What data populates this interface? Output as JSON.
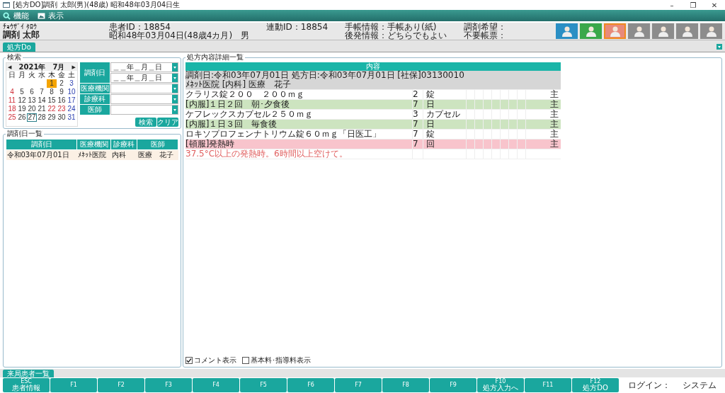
{
  "window": {
    "title": "[処方DO]調剤 太郎(男)(48歳) 昭和48年03月04日生"
  },
  "window_controls": [
    "–",
    "❐",
    "✕"
  ],
  "menu": [
    {
      "label": "機能"
    },
    {
      "label": "表示"
    }
  ],
  "patient": {
    "kana": "ﾁｮｳｻﾞｲ ﾀﾛｳ",
    "name": "調剤 太郎",
    "fields": [
      [
        "患者ID：18854",
        "昭和48年03月04日(48歳4カ月)　男"
      ],
      [
        "連動ID：18854"
      ],
      [
        "手帳情報：手帳あり(紙)",
        "後発情報：どちらでもよい"
      ],
      [
        "調剤希望：",
        "不要帳票："
      ]
    ]
  },
  "toolbar": [
    {
      "color": "#2a8fc4",
      "selected": false
    },
    {
      "color": "#3aa84a",
      "selected": false
    },
    {
      "color": "#e88a7a",
      "selected": true
    },
    {
      "color": "#8c8c8c",
      "selected": false
    },
    {
      "color": "#8c8c8c",
      "selected": false
    },
    {
      "color": "#8c8c8c",
      "selected": false
    },
    {
      "color": "#8c8c8c",
      "selected": false
    }
  ],
  "tabs": [
    {
      "label": "処方Do",
      "selected": true
    }
  ],
  "search": {
    "title": "検索",
    "calendar": {
      "month": "2021年　7月",
      "prev": "◀",
      "next": "▶",
      "weekdays": [
        "日",
        "月",
        "火",
        "水",
        "木",
        "金",
        "土"
      ],
      "weeks": [
        [
          {
            "d": "1",
            "kind": "weekday",
            "today": true,
            "selected": false
          },
          {
            "d": "2",
            "kind": "weekday",
            "today": false,
            "selected": false
          },
          {
            "d": "3",
            "kind": "saturday",
            "today": false,
            "selected": false
          }
        ],
        [
          {
            "d": "4",
            "kind": "holiday",
            "today": false,
            "selected": false
          },
          {
            "d": "5",
            "kind": "weekday",
            "today": false,
            "selected": false
          },
          {
            "d": "6",
            "kind": "weekday",
            "today": false,
            "selected": false
          },
          {
            "d": "7",
            "kind": "weekday",
            "today": false,
            "selected": false
          },
          {
            "d": "8",
            "kind": "weekday",
            "today": false,
            "selected": false
          },
          {
            "d": "9",
            "kind": "weekday",
            "today": false,
            "selected": false
          },
          {
            "d": "10",
            "kind": "saturday",
            "today": false,
            "selected": false
          }
        ],
        [
          {
            "d": "11",
            "kind": "holiday",
            "today": false,
            "selected": false
          },
          {
            "d": "12",
            "kind": "weekday",
            "today": false,
            "selected": false
          },
          {
            "d": "13",
            "kind": "weekday",
            "today": false,
            "selected": false
          },
          {
            "d": "14",
            "kind": "weekday",
            "today": false,
            "selected": false
          },
          {
            "d": "15",
            "kind": "weekday",
            "today": false,
            "selected": false
          },
          {
            "d": "16",
            "kind": "weekday",
            "today": false,
            "selected": false
          },
          {
            "d": "17",
            "kind": "saturday",
            "today": false,
            "selected": false
          }
        ],
        [
          {
            "d": "18",
            "kind": "holiday",
            "today": false,
            "selected": false
          },
          {
            "d": "19",
            "kind": "weekday",
            "today": false,
            "selected": false
          },
          {
            "d": "20",
            "kind": "weekday",
            "today": false,
            "selected": false
          },
          {
            "d": "21",
            "kind": "weekday",
            "today": false,
            "selected": false
          },
          {
            "d": "22",
            "kind": "holiday",
            "today": false,
            "selected": false
          },
          {
            "d": "23",
            "kind": "holiday",
            "today": false,
            "selected": false
          },
          {
            "d": "24",
            "kind": "saturday",
            "today": false,
            "selected": false
          }
        ],
        [
          {
            "d": "25",
            "kind": "holiday",
            "today": false,
            "selected": false
          },
          {
            "d": "26",
            "kind": "weekday",
            "today": false,
            "selected": false
          },
          {
            "d": "27",
            "kind": "weekday",
            "today": false,
            "selected": true
          },
          {
            "d": "28",
            "kind": "weekday",
            "today": false,
            "selected": false
          },
          {
            "d": "29",
            "kind": "weekday",
            "today": false,
            "selected": false
          },
          {
            "d": "30",
            "kind": "weekday",
            "today": false,
            "selected": false
          },
          {
            "d": "31",
            "kind": "saturday",
            "today": false,
            "selected": false
          }
        ]
      ]
    },
    "fields": [
      {
        "label": "調剤日",
        "values": [
          "＿＿年＿月＿日",
          "＿＿年＿月＿日"
        ]
      },
      {
        "label": "医療機関"
      },
      {
        "label": "診療科"
      },
      {
        "label": "医師"
      }
    ],
    "buttons": [
      "検索",
      "クリア"
    ]
  },
  "date_list": {
    "title": "調剤日一覧",
    "columns": [
      "調剤日",
      "医療機関",
      "診療科",
      "医師"
    ],
    "rows": [
      {
        "cells": [
          "令和03年07月01日",
          "ﾒﾈｯﾄ医院",
          "内科",
          "医療　花子"
        ],
        "selected": true
      }
    ]
  },
  "detail": {
    "title": "処方内容詳細一覧",
    "header": "内容",
    "rows": [
      {
        "kind": "header",
        "lines": [
          "調剤日:令和03年07月01日 処方日:令和03年07月01日 [社保]03130010",
          "ﾒﾈｯﾄ医院 [内科] 医療　花子"
        ]
      },
      {
        "kind": "drug",
        "text": "クラリス錠２００　２００ｍｇ",
        "qty": "2",
        "unit": "錠",
        "mark": "主"
      },
      {
        "kind": "usage",
        "text": "[内服]１日２回　朝･夕食後",
        "qty": "7",
        "unit": "日",
        "mark": "主"
      },
      {
        "kind": "drug",
        "text": "ケフレックスカプセル２５０ｍｇ",
        "qty": "3",
        "unit": "カプセル",
        "mark": "主"
      },
      {
        "kind": "usage",
        "text": "[内服]１日３回　毎食後",
        "qty": "7",
        "unit": "日",
        "mark": "主"
      },
      {
        "kind": "drug",
        "text": "ロキソプロフェンナトリウム錠６０ｍｇ「日医工」",
        "qty": "7",
        "unit": "錠",
        "mark": "主"
      },
      {
        "kind": "prn",
        "text": "[頓服]発熱時",
        "qty": "7",
        "unit": "回",
        "mark": "主"
      },
      {
        "kind": "comment",
        "text": "37.5°C以上の発熱時。6時間以上空けて。"
      }
    ],
    "options": [
      {
        "label": "コメント表示",
        "checked": true
      },
      {
        "label": "基本料･指導料表示",
        "checked": false
      }
    ]
  },
  "bottom_tab": "来局患者一覧",
  "fkeys": [
    {
      "key": "ESC",
      "label": "患者情報"
    },
    {
      "key": "F1"
    },
    {
      "key": "F2"
    },
    {
      "key": "F3"
    },
    {
      "key": "F4"
    },
    {
      "key": "F5"
    },
    {
      "key": "F6"
    },
    {
      "key": "F7"
    },
    {
      "key": "F8"
    },
    {
      "key": "F9"
    },
    {
      "key": "F10",
      "label": "処方入力へ"
    },
    {
      "key": "F11"
    },
    {
      "key": "F12",
      "label": "処方DO"
    }
  ],
  "login": {
    "label": "ログイン：",
    "user": "システム"
  }
}
